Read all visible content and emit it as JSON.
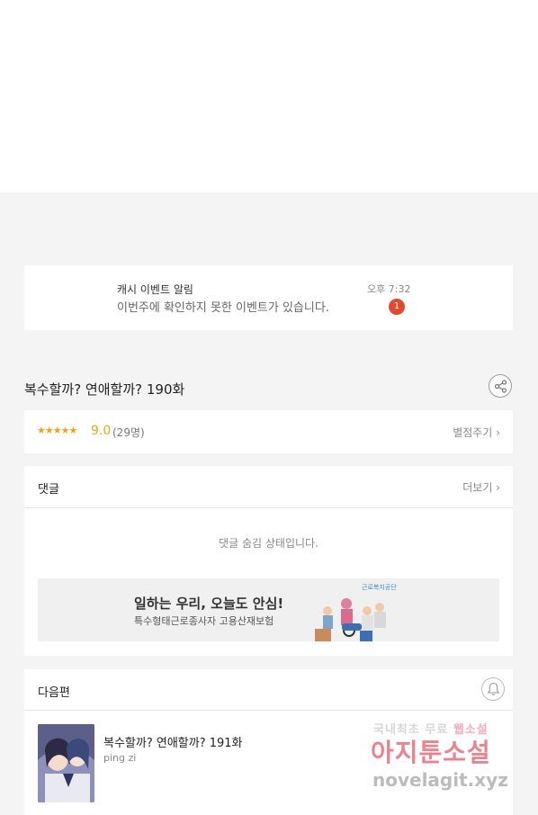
{
  "notification": {
    "title": "캐시 이벤트 알림",
    "text": "이번주에 확인하지 못한 이벤트가 있습니다.",
    "time": "오후 7:32",
    "badge": "1"
  },
  "episode": {
    "title": "복수할까? 연애할까? 190화",
    "share_icon": "share-icon"
  },
  "rating": {
    "stars": "★★★★★",
    "score": "9.0",
    "count": "(29명)",
    "rate_label": "별점주기",
    "rate_value": 0.9
  },
  "comments": {
    "title": "댓글",
    "more_label": "더보기",
    "hidden_message": "댓글 숨김 상태입니다.",
    "ad": {
      "headline": "일하는 우리, 오늘도 안심!",
      "subtext": "특수형태근로종사자 고용산재보험",
      "org": "근로복지공단"
    }
  },
  "next": {
    "title": "다음편",
    "episode_title": "복수할까? 연애할까? 191화",
    "author": "ping zi",
    "bell_icon": "bell-icon"
  },
  "watermark": {
    "line1_prefix": "국내최초 무료 ",
    "line1_highlight": "웹소설",
    "line2": "아지툰소설",
    "line3": "novelagit.xyz"
  },
  "colors": {
    "accent": "#f1a21b",
    "badge": "#e04a2f",
    "background": "#f4f4f4"
  }
}
